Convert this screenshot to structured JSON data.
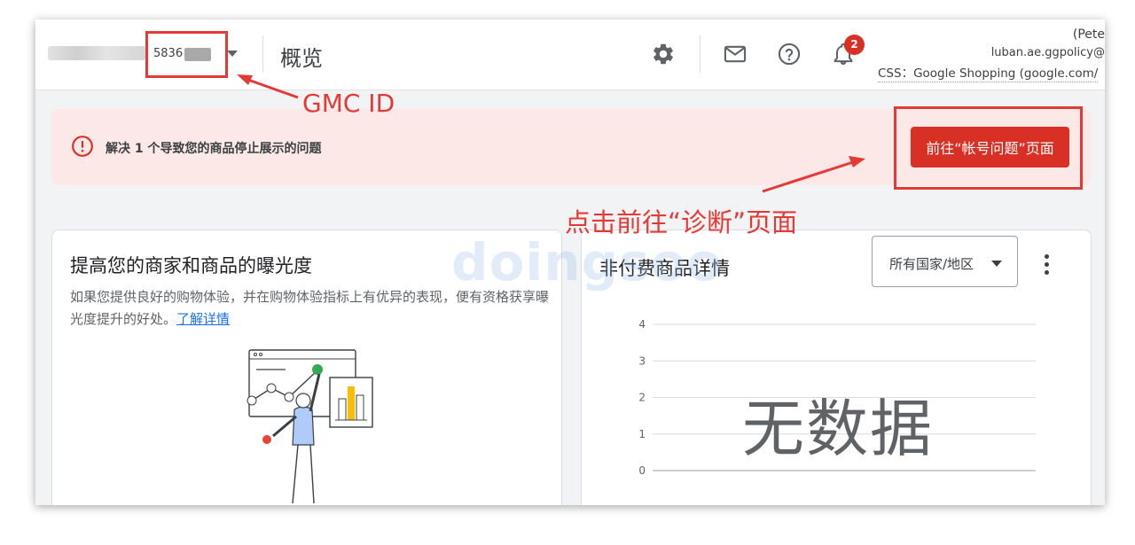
{
  "header": {
    "account_id": "5836",
    "page_title": "概览",
    "notification_count": "2",
    "user_name": "(Pete",
    "user_email": "luban.ae.ggpolicy@",
    "css_label": "CSS：Google Shopping (google.com/"
  },
  "alert": {
    "message": "解决 1 个导致您的商品停止展示的问题",
    "button_label": "前往“帐号问题”页面"
  },
  "annotations": {
    "gmc_id_label": "GMC ID",
    "click_hint": "点击前往“诊断”页面",
    "color": "#e53935"
  },
  "left_card": {
    "title": "提高您的商家和商品的曝光度",
    "description": "如果您提供良好的购物体验，并在购物体验指标上有优异的表现，便有资格获享曝光度提升的好处。",
    "link_label": "了解详情"
  },
  "right_card": {
    "title": "非付费商品详情",
    "country_filter": "所有国家/地区",
    "no_data": "无数据"
  },
  "chart_data": {
    "type": "line",
    "y_ticks": [
      "4",
      "3",
      "2",
      "1",
      "0"
    ],
    "ylim": [
      0,
      4
    ],
    "series": [],
    "grid": true
  },
  "watermark": "doingsoo",
  "colors": {
    "alert_background": "#fce8e6",
    "alert_button": "#d93025",
    "link": "#1a73e8",
    "badge": "#d93025"
  },
  "icons": {
    "settings": "gear-icon",
    "mail": "mail-icon",
    "help": "help-icon",
    "notifications": "bell-icon",
    "alert": "error-circle-icon"
  }
}
